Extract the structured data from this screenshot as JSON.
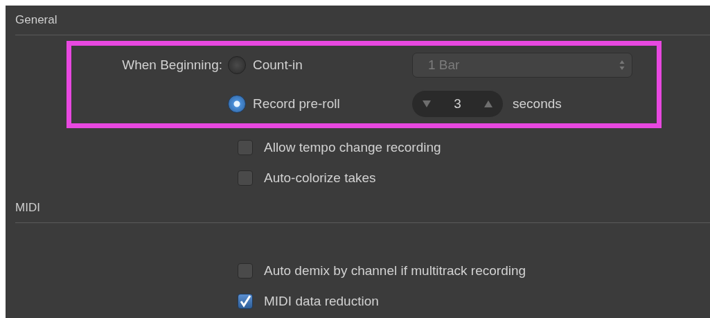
{
  "sections": [
    {
      "title": "General",
      "items": [
        {
          "kind": "radio-group",
          "label": "When Beginning:",
          "highlighted": true,
          "options": [
            {
              "kind": "select",
              "label": "Count-in",
              "selected": false,
              "value": "1 Bar",
              "disabled": true
            },
            {
              "kind": "stepper",
              "label": "Record pre-roll",
              "selected": true,
              "value": "3",
              "unit": "seconds"
            }
          ]
        },
        {
          "kind": "checkbox",
          "label": "Allow tempo change recording",
          "checked": false
        },
        {
          "kind": "checkbox",
          "label": "Auto-colorize takes",
          "checked": false
        }
      ]
    },
    {
      "title": "MIDI",
      "items": [
        {
          "kind": "checkbox",
          "label": "Auto demix by channel if multitrack recording",
          "checked": false
        },
        {
          "kind": "checkbox",
          "label": "MIDI data reduction",
          "checked": true
        }
      ]
    }
  ]
}
